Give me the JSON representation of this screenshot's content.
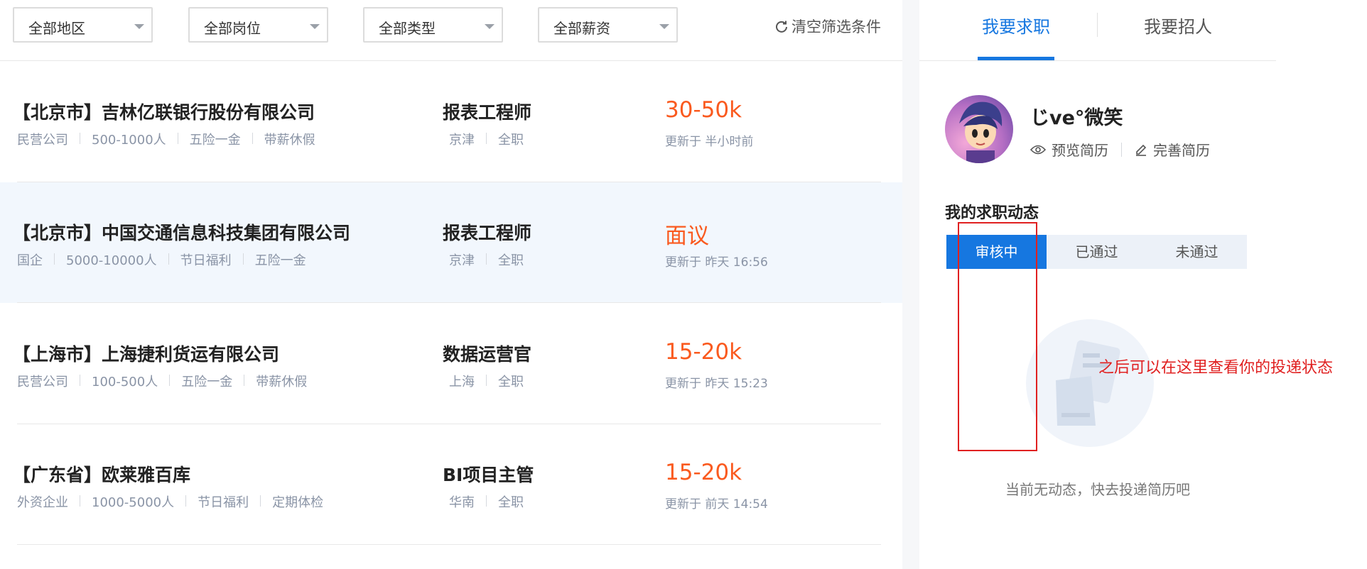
{
  "filters": {
    "region": "全部地区",
    "position": "全部岗位",
    "type": "全部类型",
    "salary": "全部薪资",
    "clear_label": "清空筛选条件"
  },
  "jobs": [
    {
      "company": "【北京市】吉林亿联银行股份有限公司",
      "tags": [
        "民营公司",
        "500-1000人",
        "五险一金",
        "带薪休假"
      ],
      "position": "报表工程师",
      "location": "京津",
      "job_type": "全职",
      "salary": "30-50k",
      "updated": "更新于 半小时前"
    },
    {
      "company": "【北京市】中国交通信息科技集团有限公司",
      "tags": [
        "国企",
        "5000-10000人",
        "节日福利",
        "五险一金"
      ],
      "position": "报表工程师",
      "location": "京津",
      "job_type": "全职",
      "salary": "面议",
      "updated": "更新于 昨天 16:56"
    },
    {
      "company": "【上海市】上海捷利货运有限公司",
      "tags": [
        "民营公司",
        "100-500人",
        "五险一金",
        "带薪休假"
      ],
      "position": "数据运营官",
      "location": "上海",
      "job_type": "全职",
      "salary": "15-20k",
      "updated": "更新于 昨天 15:23"
    },
    {
      "company": "【广东省】欧莱雅百库",
      "tags": [
        "外资企业",
        "1000-5000人",
        "节日福利",
        "定期体检"
      ],
      "position": "BI项目主管",
      "location": "华南",
      "job_type": "全职",
      "salary": "15-20k",
      "updated": "更新于 前天 14:54"
    }
  ],
  "right_panel": {
    "tabs": [
      "我要求职",
      "我要招人"
    ],
    "user": {
      "name": "じve°微笑",
      "preview_resume": "预览简历",
      "complete_resume": "完善简历"
    },
    "dynamics_title": "我的求职动态",
    "segments": [
      "审核中",
      "已通过",
      "未通过"
    ],
    "empty_text": "当前无动态，快去投递简历吧"
  },
  "annotation": "之后可以在这里查看你的投递状态",
  "colors": {
    "accent": "#1677e0",
    "salary": "#fa5a1f",
    "annotation": "#e02020"
  }
}
